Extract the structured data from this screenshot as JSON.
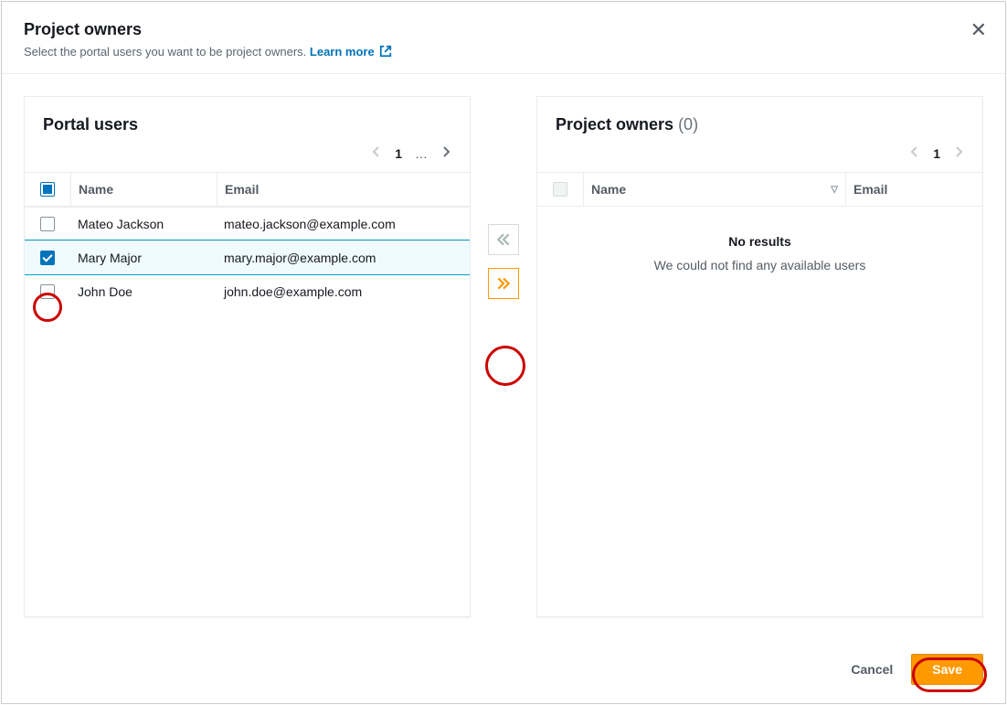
{
  "header": {
    "title": "Project owners",
    "subtitle": "Select the portal users you want to be project owners.",
    "learn_more": "Learn more"
  },
  "left_panel": {
    "title": "Portal users",
    "page": "1",
    "ellipsis": "…",
    "columns": {
      "name": "Name",
      "email": "Email"
    },
    "rows": [
      {
        "name": "Mateo Jackson",
        "email": "mateo.jackson@example.com",
        "selected": false
      },
      {
        "name": "Mary Major",
        "email": "mary.major@example.com",
        "selected": true
      },
      {
        "name": "John Doe",
        "email": "john.doe@example.com",
        "selected": false
      }
    ]
  },
  "right_panel": {
    "title": "Project owners",
    "count": "(0)",
    "page": "1",
    "columns": {
      "name": "Name",
      "email": "Email"
    },
    "empty": {
      "title": "No results",
      "message": "We could not find any available users"
    }
  },
  "footer": {
    "cancel": "Cancel",
    "save": "Save"
  }
}
